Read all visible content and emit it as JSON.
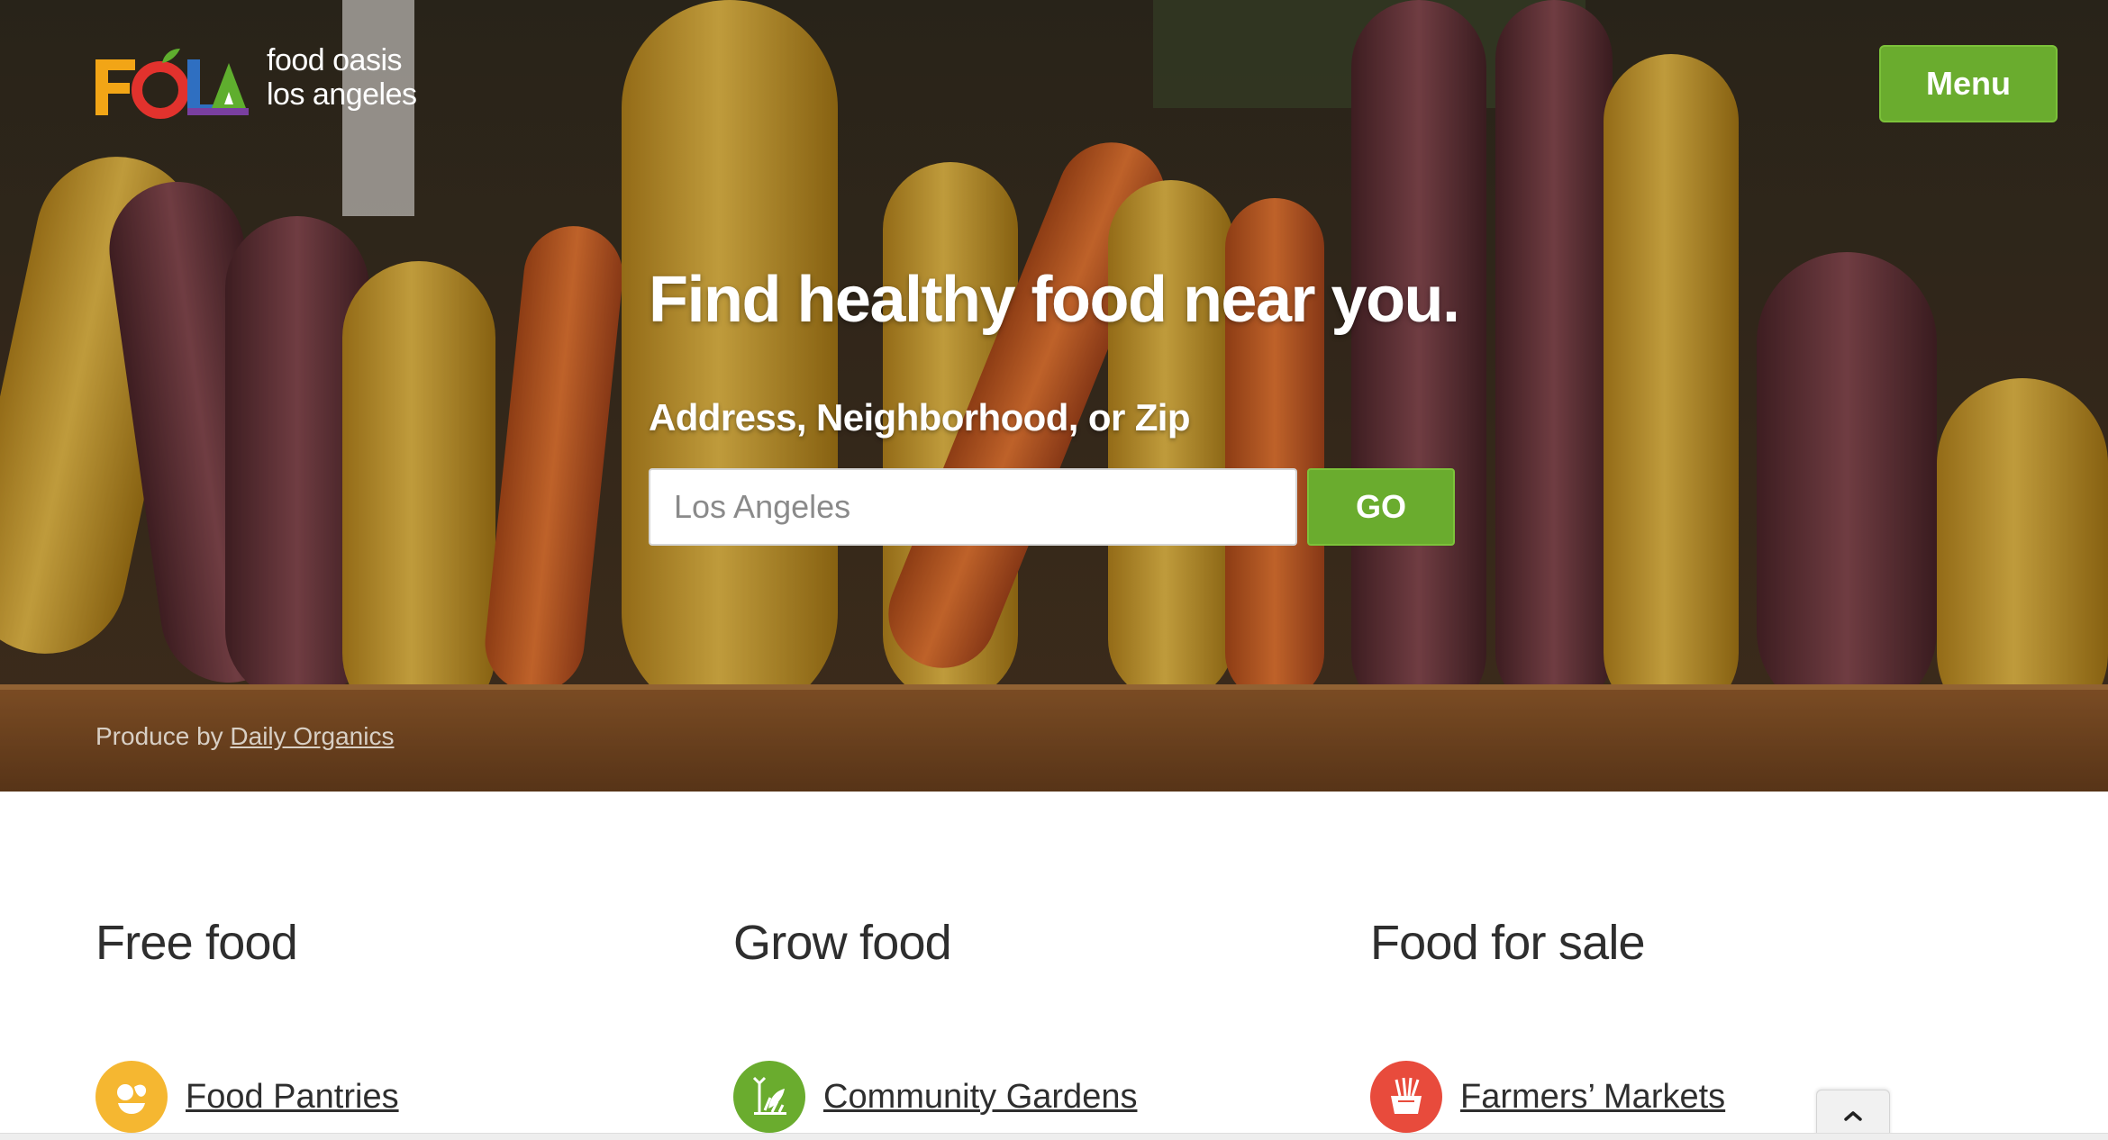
{
  "brand": {
    "logo_letters": "FOLA",
    "name_line1": "food oasis",
    "name_line2": "los angeles"
  },
  "header": {
    "menu_label": "Menu"
  },
  "hero": {
    "headline": "Find healthy food near you.",
    "search_label": "Address, Neighborhood, or Zip",
    "search_placeholder": "Los Angeles",
    "search_value": "",
    "go_label": "GO",
    "credit_prefix": "Produce by",
    "credit_link": "Daily Organics"
  },
  "categories": [
    {
      "heading": "Free food",
      "link_label": "Food Pantries",
      "icon": "food-pantry-icon",
      "icon_color": "#f5b731"
    },
    {
      "heading": "Grow food",
      "link_label": "Community Gardens",
      "icon": "community-garden-icon",
      "icon_color": "#6aac2e"
    },
    {
      "heading": "Food for sale",
      "link_label": "Farmers’ Markets",
      "icon": "farmers-market-icon",
      "icon_color": "#e84b3c"
    }
  ],
  "colors": {
    "accent_green": "#6aac2e",
    "text_dark": "#2e2e2e"
  }
}
